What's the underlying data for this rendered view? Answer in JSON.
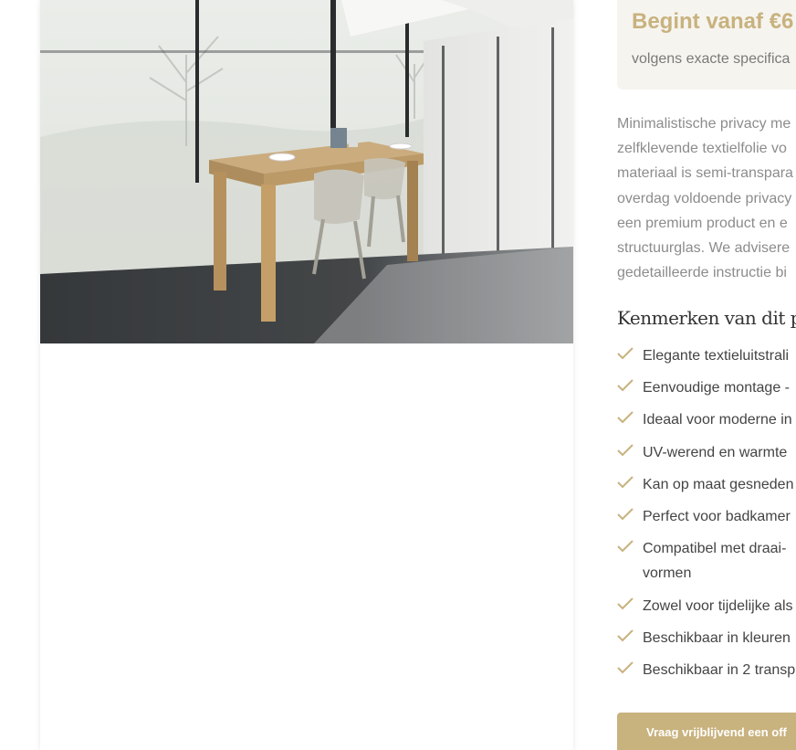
{
  "product": {
    "image_alt": "Privacy raamfolie in moderne eetkamer met houten tafel en grijze stoelen",
    "price_label": "Begint vanaf €6",
    "price_sub": "volgens exacte specifica"
  },
  "description_lines": [
    "Minimalistische privacy me",
    "zelfklevende textielfolie vo",
    "materiaal is semi-transpara",
    "overdag voldoende privacy",
    "een premium product en e",
    "structuurglas. We advisere",
    "gedetailleerde instructie bi"
  ],
  "features": {
    "title": "Kenmerken van dit pro",
    "items": [
      "Elegante textieluitstrali",
      "Eenvoudige montage -",
      "Ideaal voor moderne in",
      "UV-werend en warmte",
      "Kan op maat gesneden",
      "Perfect voor badkamer",
      "Compatibel met draai-",
      "vormen",
      "Zowel voor tijdelijke als",
      "Beschikbaar in kleuren",
      "Beschikbaar in 2 transp"
    ]
  },
  "cta": {
    "label": "Vraag vrijblijvend een off"
  },
  "colors": {
    "accent": "#c8b27e",
    "price_box_bg": "#f6f4ef",
    "text_muted": "#8c8c8c",
    "check": "#c8b27e"
  }
}
